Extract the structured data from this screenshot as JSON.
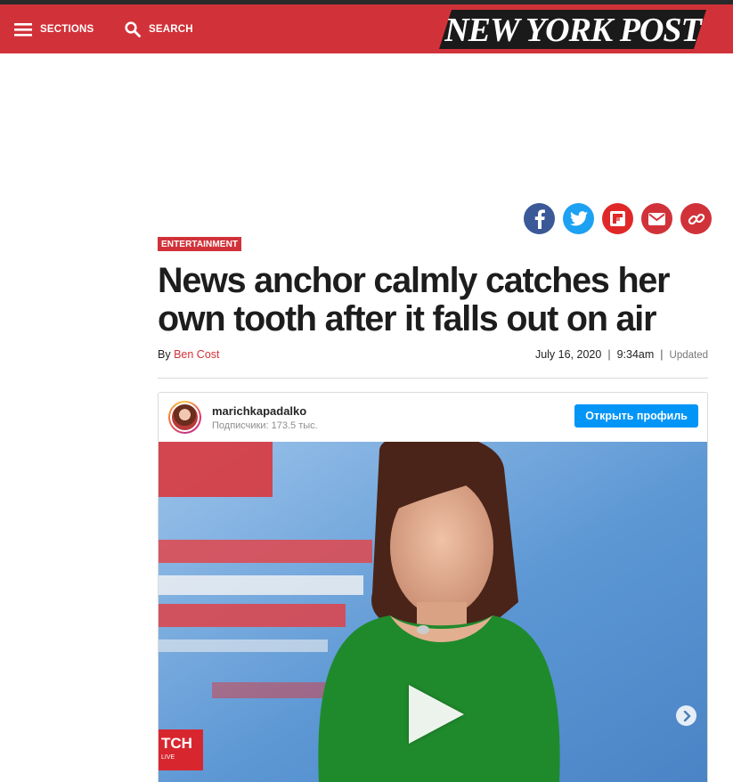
{
  "header": {
    "sections_label": "SECTIONS",
    "search_label": "SEARCH",
    "logo_text": "NEW YORK POST",
    "bg_color": "#d13239"
  },
  "share": {
    "icons": [
      "facebook-icon",
      "twitter-icon",
      "flipboard-icon",
      "email-icon",
      "copy-link-icon"
    ],
    "colors": {
      "facebook": "#3b5998",
      "twitter": "#1da1f2",
      "flipboard": "#e12828",
      "email": "#d13239",
      "link": "#d13239"
    }
  },
  "article": {
    "category": "ENTERTAINMENT",
    "headline": "News anchor calmly catches her own tooth after it falls out on air",
    "byline_prefix": "By",
    "author": "Ben Cost",
    "date": "July 16, 2020",
    "time": "9:34am",
    "updated_label": "Updated"
  },
  "embed": {
    "username": "marichkapadalko",
    "followers": "Подписчики: 173.5 тыс.",
    "profile_button": "Открыть профиль",
    "channel_logo": "ТСН",
    "channel_sub": "LIVE"
  }
}
